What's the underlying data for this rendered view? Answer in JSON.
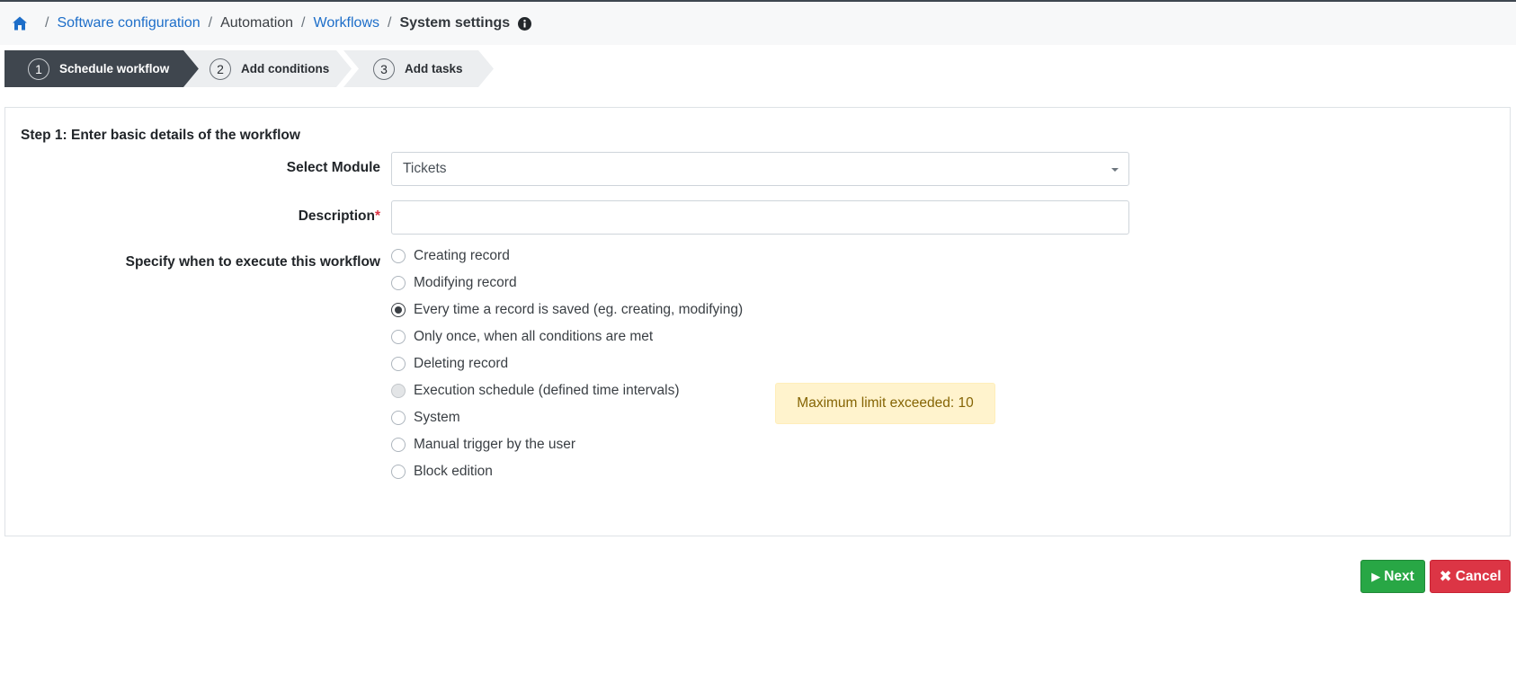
{
  "breadcrumb": {
    "items": [
      "Software configuration",
      "Automation",
      "Workflows"
    ],
    "current": "System settings",
    "separator": "/"
  },
  "steps": [
    {
      "number": "1",
      "label": "Schedule workflow",
      "active": true
    },
    {
      "number": "2",
      "label": "Add conditions",
      "active": false
    },
    {
      "number": "3",
      "label": "Add tasks",
      "active": false
    }
  ],
  "form": {
    "title": "Step 1: Enter basic details of the workflow",
    "module_label": "Select Module",
    "module_value": "Tickets",
    "description_label": "Description",
    "required_marker": "*",
    "description_value": "",
    "execute_label": "Specify when to execute this workflow",
    "options": [
      {
        "label": "Creating record",
        "state": "unchecked"
      },
      {
        "label": "Modifying record",
        "state": "unchecked"
      },
      {
        "label": "Every time a record is saved (eg. creating, modifying)",
        "state": "checked"
      },
      {
        "label": "Only once, when all conditions are met",
        "state": "unchecked"
      },
      {
        "label": "Deleting record",
        "state": "unchecked"
      },
      {
        "label": "Execution schedule (defined time intervals)",
        "state": "disabled"
      },
      {
        "label": "System",
        "state": "unchecked"
      },
      {
        "label": "Manual trigger by the user",
        "state": "unchecked"
      },
      {
        "label": "Block edition",
        "state": "unchecked"
      }
    ],
    "alert": "Maximum limit exceeded: 10"
  },
  "actions": {
    "next_label": "Next",
    "cancel_label": "Cancel"
  },
  "colors": {
    "link": "#1d6ec9",
    "active_step": "#3f464e",
    "next": "#28a745",
    "cancel": "#dc3545",
    "alert_bg": "#fff3cd",
    "alert_text": "#856404"
  },
  "icons": {
    "home": "home-icon",
    "info": "info-circle-icon",
    "next": "caret-right-icon",
    "cancel": "times-icon",
    "dropdown": "caret-down-icon"
  }
}
